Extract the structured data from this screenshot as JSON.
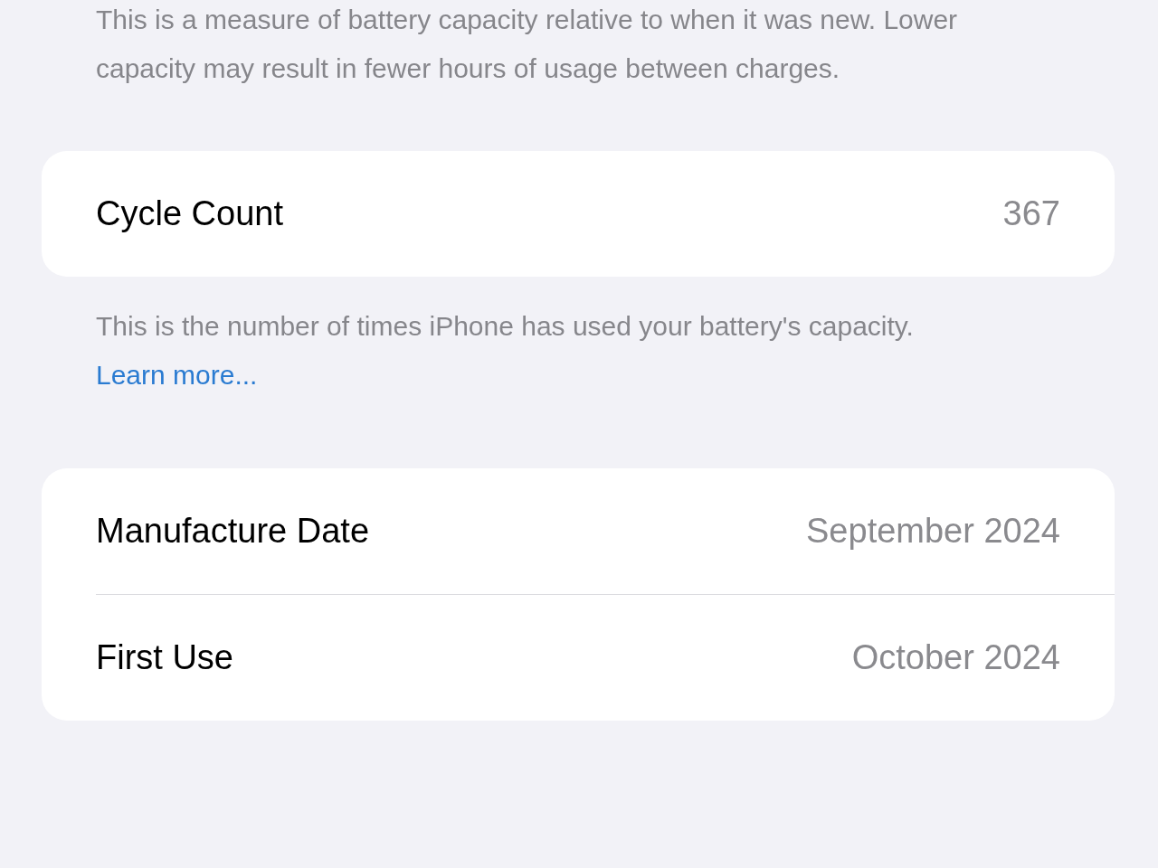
{
  "capacity_note": "This is a measure of battery capacity relative to when it was new. Lower capacity may result in fewer hours of usage between charges.",
  "cycle_card": {
    "rows": [
      {
        "label": "Cycle Count",
        "value": "367"
      }
    ]
  },
  "cycle_note": {
    "text": "This is the number of times iPhone has used your battery's capacity.",
    "link": "Learn more..."
  },
  "dates_card": {
    "rows": [
      {
        "label": "Manufacture Date",
        "value": "September 2024"
      },
      {
        "label": "First Use",
        "value": "October 2024"
      }
    ]
  }
}
